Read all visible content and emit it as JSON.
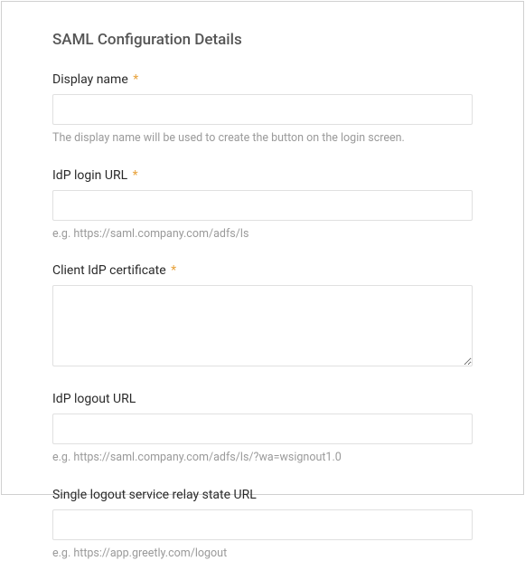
{
  "section": {
    "title": "SAML Configuration Details"
  },
  "fields": {
    "display_name": {
      "label": "Display name",
      "required_marker": "*",
      "value": "",
      "help": "The display name will be used to create the button on the login screen."
    },
    "idp_login_url": {
      "label": "IdP login URL",
      "required_marker": "*",
      "value": "",
      "help": "e.g. https://saml.company.com/adfs/ls"
    },
    "client_idp_certificate": {
      "label": "Client IdP certificate",
      "required_marker": "*",
      "value": ""
    },
    "idp_logout_url": {
      "label": "IdP logout URL",
      "value": "",
      "help": "e.g. https://saml.company.com/adfs/ls/?wa=wsignout1.0"
    },
    "slo_relay_state_url": {
      "label": "Single logout service relay state URL",
      "value": "",
      "help": "e.g. https://app.greetly.com/logout"
    }
  }
}
